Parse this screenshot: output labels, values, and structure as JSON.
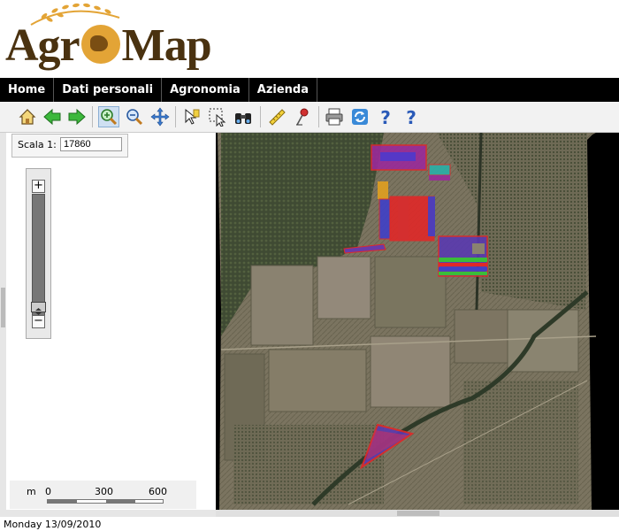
{
  "app": {
    "logo_text": "AgroMap"
  },
  "menu": {
    "items": [
      {
        "label": "Home"
      },
      {
        "label": "Dati personali"
      },
      {
        "label": "Agronomia"
      },
      {
        "label": "Azienda"
      }
    ]
  },
  "toolbar": {
    "tools": [
      {
        "icon": "home-icon"
      },
      {
        "icon": "arrow-left-icon"
      },
      {
        "icon": "arrow-right-icon"
      },
      {
        "icon": "zoom-in-icon",
        "active": true
      },
      {
        "icon": "zoom-out-icon"
      },
      {
        "icon": "pan-icon"
      },
      {
        "icon": "identify-icon"
      },
      {
        "icon": "select-icon"
      },
      {
        "icon": "binoculars-icon"
      },
      {
        "icon": "measure-icon"
      },
      {
        "icon": "pin-icon"
      },
      {
        "icon": "print-icon"
      },
      {
        "icon": "refresh-icon"
      },
      {
        "icon": "help-icon"
      },
      {
        "icon": "help-icon"
      }
    ]
  },
  "scale": {
    "label": "Scala 1:",
    "value": "17860"
  },
  "zoom": {
    "plus": "+",
    "minus": "−",
    "level": 0.1
  },
  "scalebar": {
    "unit": "m",
    "ticks": [
      "0",
      "300",
      "600"
    ]
  },
  "status": {
    "date": "Monday 13/09/2010"
  },
  "colors": {
    "menu_bg": "#000000",
    "parcel_red": "#e02828",
    "parcel_blue": "#4040c8",
    "parcel_purple": "#9a2a9a"
  }
}
